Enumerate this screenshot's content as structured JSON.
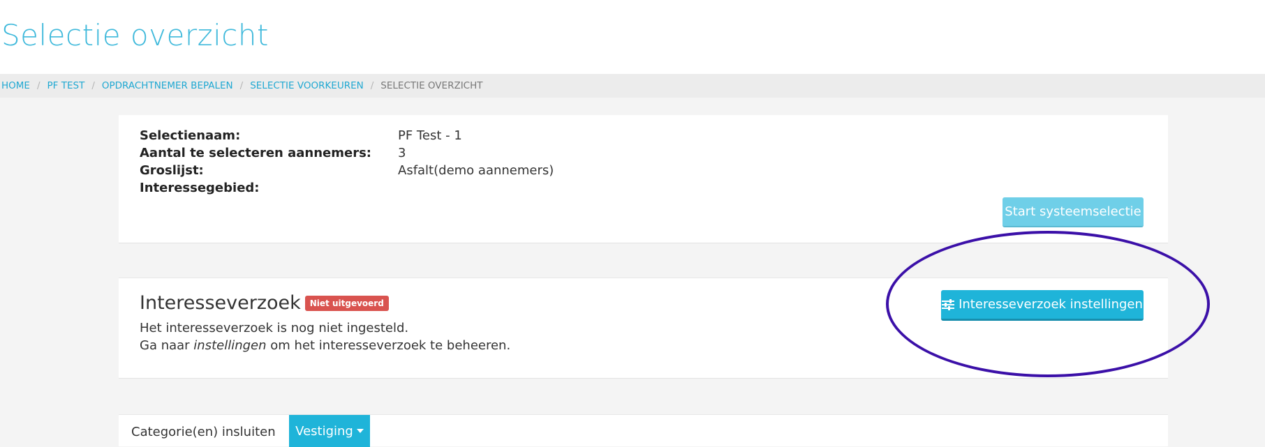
{
  "page": {
    "title": "Selectie overzicht"
  },
  "breadcrumb": [
    "HOME",
    "PF TEST",
    "OPDRACHTNEMER BEPALEN",
    "SELECTIE VOORKEUREN",
    "SELECTIE OVERZICHT"
  ],
  "details": {
    "rows": [
      {
        "label": "Selectienaam:",
        "value": "PF Test - 1"
      },
      {
        "label": "Aantal te selecteren aannemers:",
        "value": "3"
      },
      {
        "label": "Groslijst:",
        "value": "Asfalt(demo aannemers)"
      },
      {
        "label": "Interessegebied:",
        "value": ""
      }
    ],
    "start_button": "Start systeemselectie"
  },
  "interest": {
    "title": "Interesseverzoek",
    "badge": "Niet uitgevoerd",
    "line1": "Het interesseverzoek is nog niet ingesteld.",
    "line2_prefix": "Ga naar ",
    "line2_em": "instellingen",
    "line2_suffix": " om het interesseverzoek te beheeren.",
    "settings_button": "Interesseverzoek instellingen",
    "settings_icon": "sliders-icon"
  },
  "category": {
    "label": "Categorie(en) insluiten",
    "dropdown": "Vestiging",
    "dropdown_icon": "caret-down-icon"
  },
  "colors": {
    "accent": "#1fb4d9",
    "title": "#3fb9db",
    "badge": "#d9534f",
    "annotation": "#3b10a8"
  }
}
